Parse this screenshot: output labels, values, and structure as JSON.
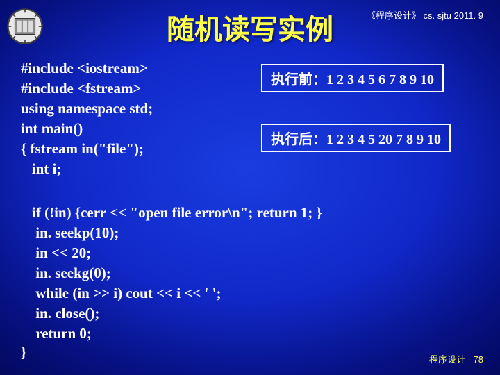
{
  "header_note": "《程序设计》 cs. sjtu  2011. 9",
  "title": "随机读写实例",
  "code_top": "#include <iostream>\n#include <fstream>\nusing namespace std;\nint main()\n{ fstream in(\"file\");\n   int i;",
  "box_before": "执行前：1 2 3 4 5 6 7 8 9 10",
  "box_after": "执行后：1 2 3 4 5 20 7 8 9 10",
  "code_bottom": "if (!in) {cerr << \"open file error\\n\"; return 1; }\n in. seekp(10);\n in << 20;\n in. seekg(0);\n while (in >> i) cout << i << ' ';\n in. close();\n return 0;",
  "closing_brace": "}",
  "footer": "程序设计 - 78"
}
